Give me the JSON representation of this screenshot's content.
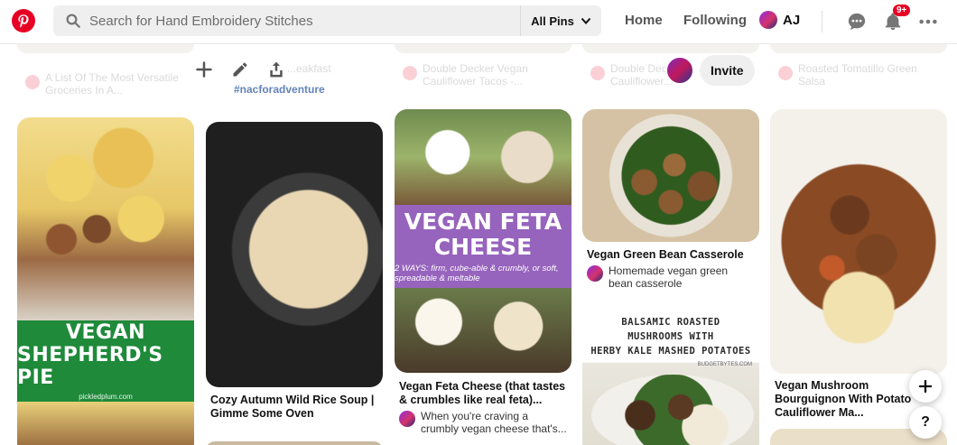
{
  "header": {
    "search_placeholder": "Search for Hand Embroidery Stitches",
    "scope_label": "All Pins",
    "nav_home": "Home",
    "nav_following": "Following",
    "user_name": "AJ",
    "notification_count": "9+"
  },
  "faded_row": {
    "items": [
      {
        "title_line1": "A List Of The Most Versatile",
        "title_line2": "Groceries In A..."
      },
      {
        "title_line1": "...eakfast",
        "title_line2": ""
      },
      {
        "title_line1": "Double Decker Vegan",
        "title_line2": "Cauliflower Tacos -..."
      },
      {
        "title_line1": "Double Decker...",
        "title_line2": "Cauliflower..."
      },
      {
        "title_line1": "Roasted Tomatillo Green",
        "title_line2": "Salsa"
      }
    ],
    "hashtag": "#nacforadventure"
  },
  "actions": {
    "invite_label": "Invite"
  },
  "pins": {
    "shepherd": {
      "banner_line1": "VEGAN",
      "banner_line2": "SHEPHERD'S PIE",
      "credit": "pickledplum.com"
    },
    "soup": {
      "title": "Cozy Autumn Wild Rice Soup | Gimme Some Oven"
    },
    "feta": {
      "banner_line1": "VEGAN FETA",
      "banner_line2": "CHEESE",
      "banner_sub": "2 WAYS: firm, cube-able & crumbly, or soft, spreadable & meltable",
      "title": "Vegan Feta Cheese (that tastes & crumbles like real feta)...",
      "desc": "When you're craving a crumbly vegan cheese that's..."
    },
    "green_bean": {
      "title": "Vegan Green Bean Casserole",
      "desc": "Homemade vegan green bean casserole"
    },
    "balsamic": {
      "line1": "BALSAMIC ROASTED",
      "line2": "MUSHROOMS WITH",
      "line3": "HERBY KALE MASHED POTATOES",
      "credit": "BUDGETBYTES.COM"
    },
    "bourguignon": {
      "title": "Vegan Mushroom Bourguignon With Potato Cauliflower Ma..."
    }
  },
  "floating": {
    "plus_label": "+",
    "help_label": "?"
  },
  "colors": {
    "brand": "#e60023",
    "shepherd_banner": "#1f8a3a",
    "feta_banner": "#9663bd"
  },
  "icons": [
    "pinterest-logo-icon",
    "search-icon",
    "chevron-down-icon",
    "chat-icon",
    "bell-icon",
    "more-icon",
    "plus-icon",
    "pencil-icon",
    "share-icon"
  ]
}
